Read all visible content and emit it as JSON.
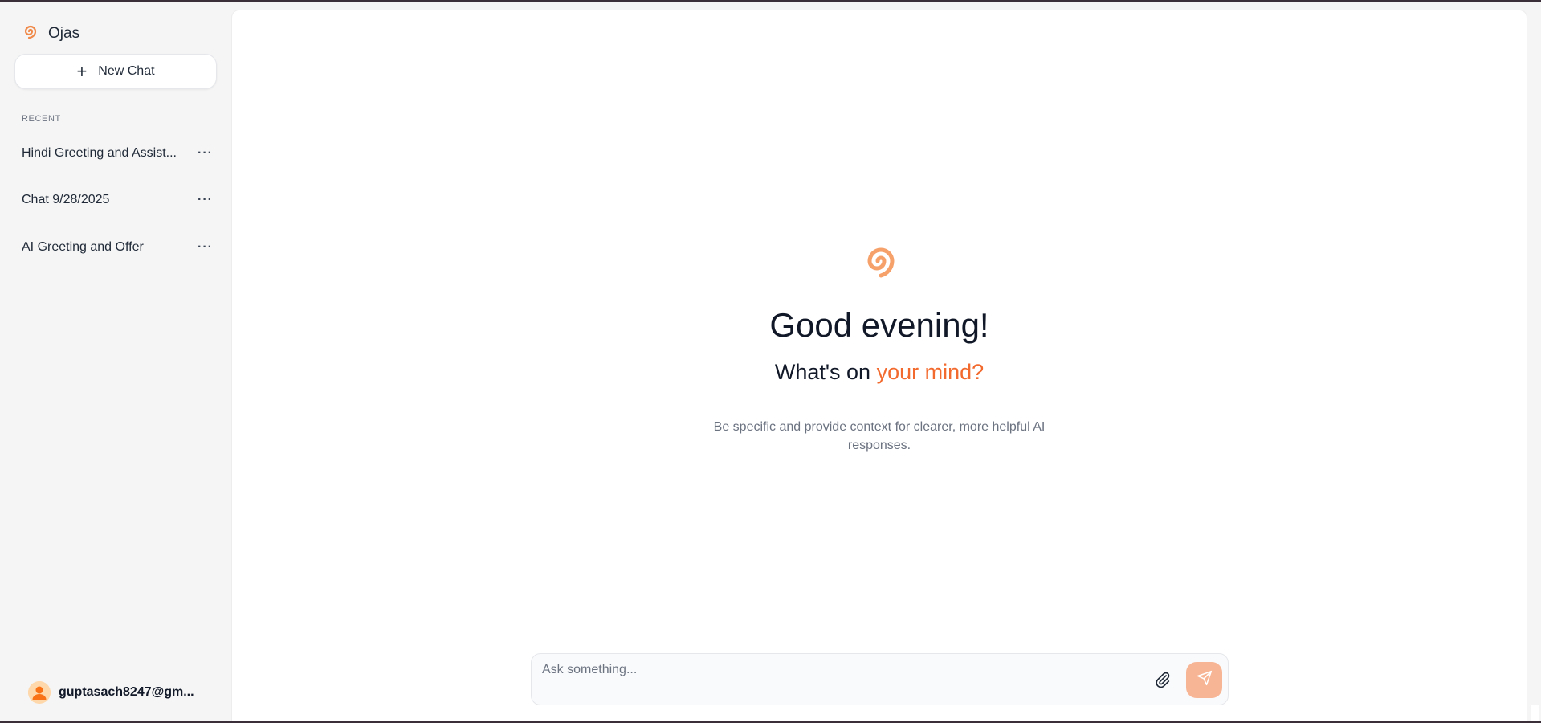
{
  "app": {
    "name": "Ojas",
    "logo_icon": "spiral-logo-icon",
    "accent_color": "#f26a2e"
  },
  "sidebar": {
    "new_chat_label": "New Chat",
    "recent_label": "RECENT",
    "chats": [
      {
        "label": "Hindi Greeting and Assist...",
        "menu": "···"
      },
      {
        "label": "Chat 9/28/2025",
        "menu": "···"
      },
      {
        "label": "AI Greeting and Offer",
        "menu": "···"
      }
    ],
    "user_email": "guptasach8247@gm..."
  },
  "main": {
    "greeting": "Good evening!",
    "subgreeting_prefix": "What's on ",
    "subgreeting_accent": "your mind?",
    "hint": "Be specific and provide context for clearer, more helpful AI responses."
  },
  "composer": {
    "placeholder": "Ask something...",
    "attach_icon": "paperclip-icon",
    "send_icon": "send-icon"
  }
}
